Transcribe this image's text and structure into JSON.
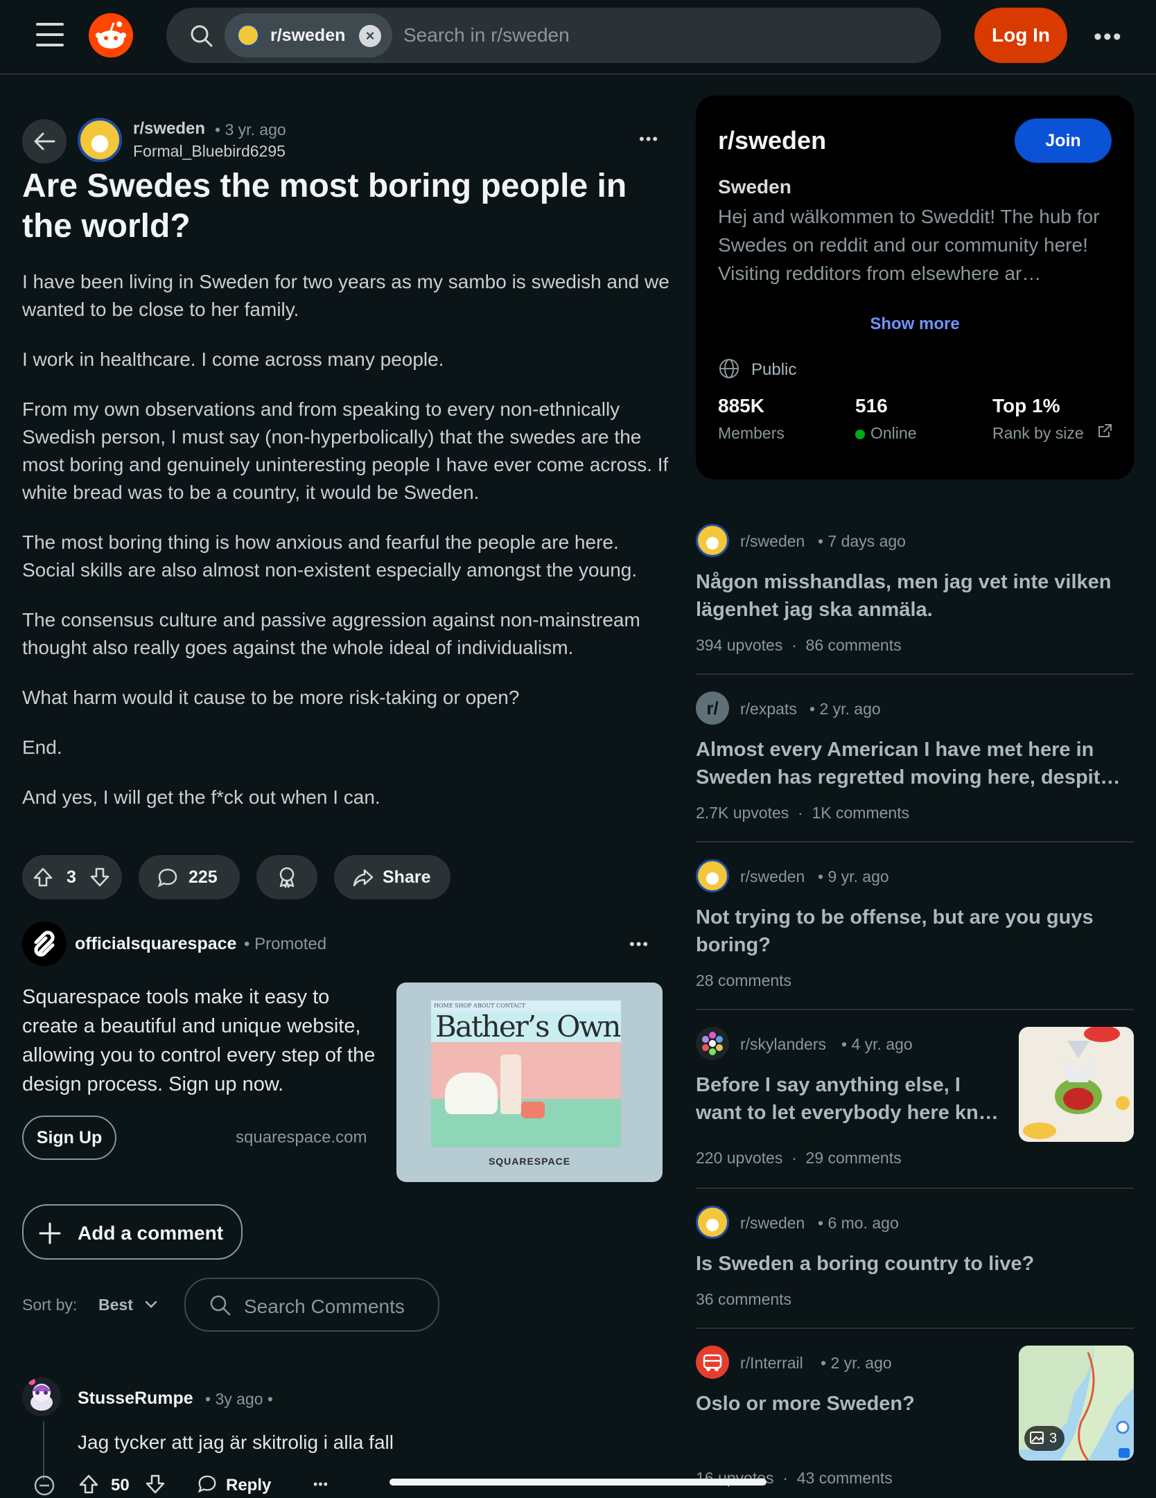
{
  "header": {
    "community_chip": "r/sweden",
    "search_placeholder": "Search in r/sweden",
    "login_label": "Log In"
  },
  "post": {
    "subreddit": "r/sweden",
    "age": "• 3 yr. ago",
    "author": "Formal_Bluebird6295",
    "title": "Are Swedes the most boring people in the world?",
    "paragraphs": [
      "I have been living in Sweden for two years as my sambo is swedish and we wanted to be close to her family.",
      "I work in healthcare. I come across many people.",
      "From my own observations and from speaking to every non-ethnically Swedish person, I must say (non-hyperbolically) that the swedes are the most boring and genuinely uninteresting people I have ever come across. If white bread was to be a country, it would be Sweden.",
      "The most boring thing is how anxious and fearful the people are here. Social skills are also almost non-existent especially amongst the young.",
      "The consensus culture and passive aggression against non-mainstream thought also really goes against the whole ideal of individualism.",
      "What harm would it cause to be more risk-taking or open?",
      "End.",
      "And yes, I will get the f*ck out when I can."
    ],
    "votes": "3",
    "comments": "225",
    "share_label": "Share"
  },
  "ad": {
    "advertiser": "officialsquarespace",
    "promoted": "• Promoted",
    "text": "Squarespace tools make it easy to create a beautiful and unique website, allowing you to control every step of the design process. Sign up now.",
    "cta": "Sign Up",
    "domain": "squarespace.com",
    "image_nav": "HOME   SHOP   ABOUT   CONTACT",
    "image_headline": "Bather’s Own",
    "image_brand": "SQUARESPACE"
  },
  "comments_section": {
    "add_comment": "Add a comment",
    "sort_label": "Sort by:",
    "sort_value": "Best",
    "search_placeholder": "Search Comments",
    "first_comment": {
      "author": "StusseRumpe",
      "age": "• 3y ago •",
      "text": "Jag tycker att jag är skitrolig i alla fall",
      "votes": "50",
      "reply_label": "Reply"
    }
  },
  "sidebar": {
    "name": "r/sweden",
    "join_label": "Join",
    "display_title": "Sweden",
    "description": "Hej and wälkommen to Sweddit! The hub for Swedes on reddit and our community here! Visiting redditors from elsewhere ar…",
    "show_more": "Show more",
    "visibility": "Public",
    "members_value": "885K",
    "members_label": "Members",
    "online_value": "516",
    "online_label": "Online",
    "rank_value": "Top 1%",
    "rank_label": "Rank by size"
  },
  "related": [
    {
      "sub": "r/sweden",
      "age": "• 7 days ago",
      "title": "Någon misshandlas, men jag vet inte vilken lägenhet jag ska anmäla.",
      "stats": "394 upvotes  ·  86 comments"
    },
    {
      "sub": "r/expats",
      "age": "• 2 yr. ago",
      "title": "Almost every American I have met here in Sweden has regretted moving here, despit…",
      "stats": "2.7K upvotes  ·  1K comments"
    },
    {
      "sub": "r/sweden",
      "age": "• 9 yr. ago",
      "title": "Not trying to be offense, but are you guys boring?",
      "stats": "28 comments"
    },
    {
      "sub": "r/skylanders",
      "age": "• 4 yr. ago",
      "title": "Before I say anything else, I want to let everybody here kn…",
      "stats": "220 upvotes  ·  29 comments"
    },
    {
      "sub": "r/sweden",
      "age": "• 6 mo. ago",
      "title": "Is Sweden a boring country to live?",
      "stats": "36 comments"
    },
    {
      "sub": "r/Interrail",
      "age": "• 2 yr. ago",
      "title": "Oslo or more Sweden?",
      "stats": "16 upvotes  ·  43 comments",
      "gallery_count": "3"
    }
  ],
  "colors": {
    "background": "#0b1416",
    "login": "#d93a00",
    "join": "#0a52d6",
    "link": "#7193ff",
    "online_dot": "#01a816"
  }
}
